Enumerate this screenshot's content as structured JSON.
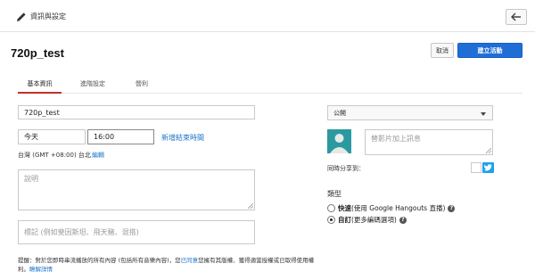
{
  "topbar": {
    "title": "資訊與設定"
  },
  "header": {
    "event_title": "720p_test",
    "cancel_label": "取消",
    "create_label": "建立活動"
  },
  "tabs": [
    {
      "label": "基本資訊",
      "active": true
    },
    {
      "label": "進階設定",
      "active": false
    },
    {
      "label": "營利",
      "active": false
    }
  ],
  "form": {
    "title_value": "720p_test",
    "date_value": "今天",
    "time_value": "16:00",
    "add_end_time_link": "新增結束時間",
    "timezone_label": "台灣 (GMT +08:00) 台北",
    "timezone_edit_link": "編輯",
    "description_placeholder": "說明",
    "tags_placeholder": "標記 (例如斐因斯坦、飛天豬、混搭)",
    "notice_prefix": "提醒：對於您即時串流播放的所有內容 (包括所有音樂內容)，您",
    "notice_agree_link": "已同意",
    "notice_middle": "您擁有其版權、獲得適當授權或已取得使用權利。",
    "notice_learn_more_link": "瞭解詳情"
  },
  "privacy": {
    "selected": "公開"
  },
  "share": {
    "message_placeholder": "替影片加上訊息",
    "share_to_label": "同時分享到："
  },
  "type_section": {
    "heading": "類型",
    "options": [
      {
        "name": "快速",
        "description": " (使用 Google Hangouts 直播)",
        "checked": false
      },
      {
        "name": "自訂",
        "description": " (更多編碼選項)",
        "checked": true
      }
    ]
  },
  "colors": {
    "accent": "#1f6ed8",
    "tab_active": "#c4302b",
    "link": "#1a73c9",
    "avatar_bg": "#2a9aa0",
    "twitter": "#1da1f2"
  },
  "icons": [
    "pencil-icon",
    "back-arrow-icon",
    "dropdown-caret-icon",
    "avatar-icon",
    "twitter-icon",
    "help-icon",
    "resize-handle-icon"
  ]
}
